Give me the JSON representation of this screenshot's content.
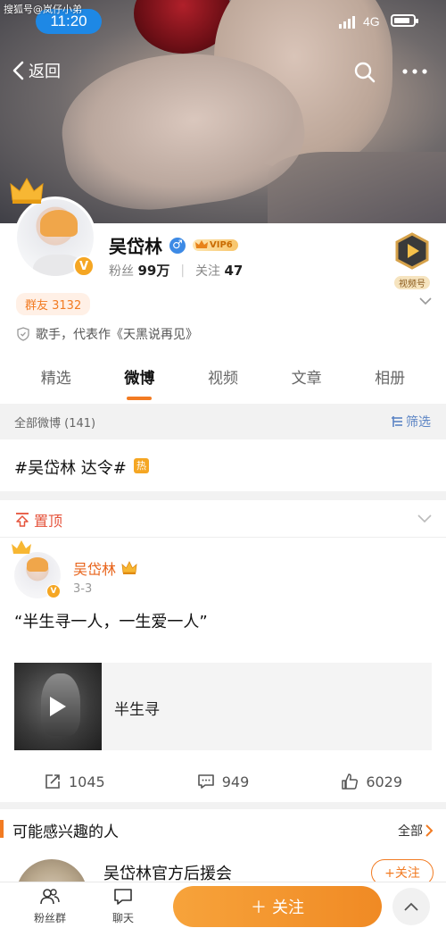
{
  "watermark": "搜狐号@岚仔小弟",
  "status": {
    "time": "11:20",
    "network": "4G",
    "battery_level": 0.85
  },
  "nav": {
    "back_label": "返回"
  },
  "profile": {
    "name": "吴岱林",
    "vip_label": "VIP6",
    "verified_mark": "V",
    "fans_label": "粉丝",
    "fans_count": "99万",
    "following_label": "关注",
    "following_count": "47",
    "video_badge_label": "视频号",
    "group_chip": "群友 3132",
    "intro": "歌手，代表作《天黑说再见》"
  },
  "tabs": [
    {
      "label": "精选",
      "active": false
    },
    {
      "label": "微博",
      "active": true
    },
    {
      "label": "视频",
      "active": false
    },
    {
      "label": "文章",
      "active": false
    },
    {
      "label": "相册",
      "active": false
    }
  ],
  "filter_bar": {
    "all_label": "全部微博 (141)",
    "filter_label": "筛选"
  },
  "hashtag": {
    "text": "#吴岱林 达令#",
    "hot_label": "热"
  },
  "pinned": {
    "label": "置顶"
  },
  "post": {
    "author": "吴岱林",
    "date": "3-3",
    "text": "“半生寻一人，一生爱一人”",
    "media_title": "半生寻",
    "reposts": "1045",
    "comments": "949",
    "likes": "6029"
  },
  "interest": {
    "heading": "可能感兴趣的人",
    "all_label": "全部",
    "rec_name": "吴岱林官方后援会",
    "follow_label": "+关注"
  },
  "bottom_bar": {
    "fans_group_label": "粉丝群",
    "chat_label": "聊天",
    "follow_label": "关注"
  },
  "colors": {
    "accent": "#f27b22",
    "link": "#5b84c4",
    "pinned": "#e5533b",
    "time_pill": "#1e88e5"
  }
}
